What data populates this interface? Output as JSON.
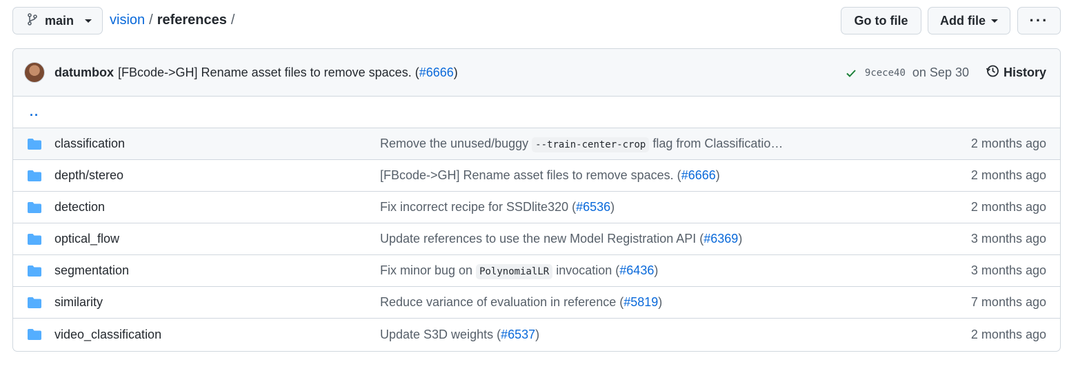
{
  "branch": {
    "label": "main"
  },
  "breadcrumb": {
    "repo": "vision",
    "sep1": "/",
    "current": "references",
    "sep2": "/"
  },
  "buttons": {
    "go_to_file": "Go to file",
    "add_file": "Add file",
    "more": "···"
  },
  "commit": {
    "author": "datumbox",
    "message": "[FBcode->GH] Rename asset files to remove spaces. (",
    "pr": "#6666",
    "message_end": ")",
    "sha": "9cece40",
    "date": "on Sep 30",
    "history": "History"
  },
  "parent_link": "..",
  "files": [
    {
      "name": "classification",
      "msg_pre": "Remove the unused/buggy ",
      "code": "--train-center-crop",
      "msg_post": " flag from Classificatio…",
      "pr": "",
      "pr_close": "",
      "age": "2 months ago"
    },
    {
      "name": "depth/stereo",
      "msg_pre": "[FBcode->GH] Rename asset files to remove spaces. (",
      "code": "",
      "msg_post": "",
      "pr": "#6666",
      "pr_close": ")",
      "age": "2 months ago"
    },
    {
      "name": "detection",
      "msg_pre": "Fix incorrect recipe for SSDlite320 (",
      "code": "",
      "msg_post": "",
      "pr": "#6536",
      "pr_close": ")",
      "age": "2 months ago"
    },
    {
      "name": "optical_flow",
      "msg_pre": "Update references to use the new Model Registration API (",
      "code": "",
      "msg_post": "",
      "pr": "#6369",
      "pr_close": ")",
      "age": "3 months ago"
    },
    {
      "name": "segmentation",
      "msg_pre": "Fix minor bug on ",
      "code": "PolynomialLR",
      "msg_post": " invocation (",
      "pr": "#6436",
      "pr_close": ")",
      "age": "3 months ago"
    },
    {
      "name": "similarity",
      "msg_pre": "Reduce variance of evaluation in reference (",
      "code": "",
      "msg_post": "",
      "pr": "#5819",
      "pr_close": ")",
      "age": "7 months ago"
    },
    {
      "name": "video_classification",
      "msg_pre": "Update S3D weights (",
      "code": "",
      "msg_post": "",
      "pr": "#6537",
      "pr_close": ")",
      "age": "2 months ago"
    }
  ],
  "icons": {
    "branch": "git-branch-icon",
    "folder": "folder-icon",
    "check": "check-icon",
    "history": "history-icon"
  },
  "colors": {
    "link": "#0969da",
    "folder": "#54aeff",
    "success": "#1a7f37",
    "border": "#d0d7de"
  }
}
